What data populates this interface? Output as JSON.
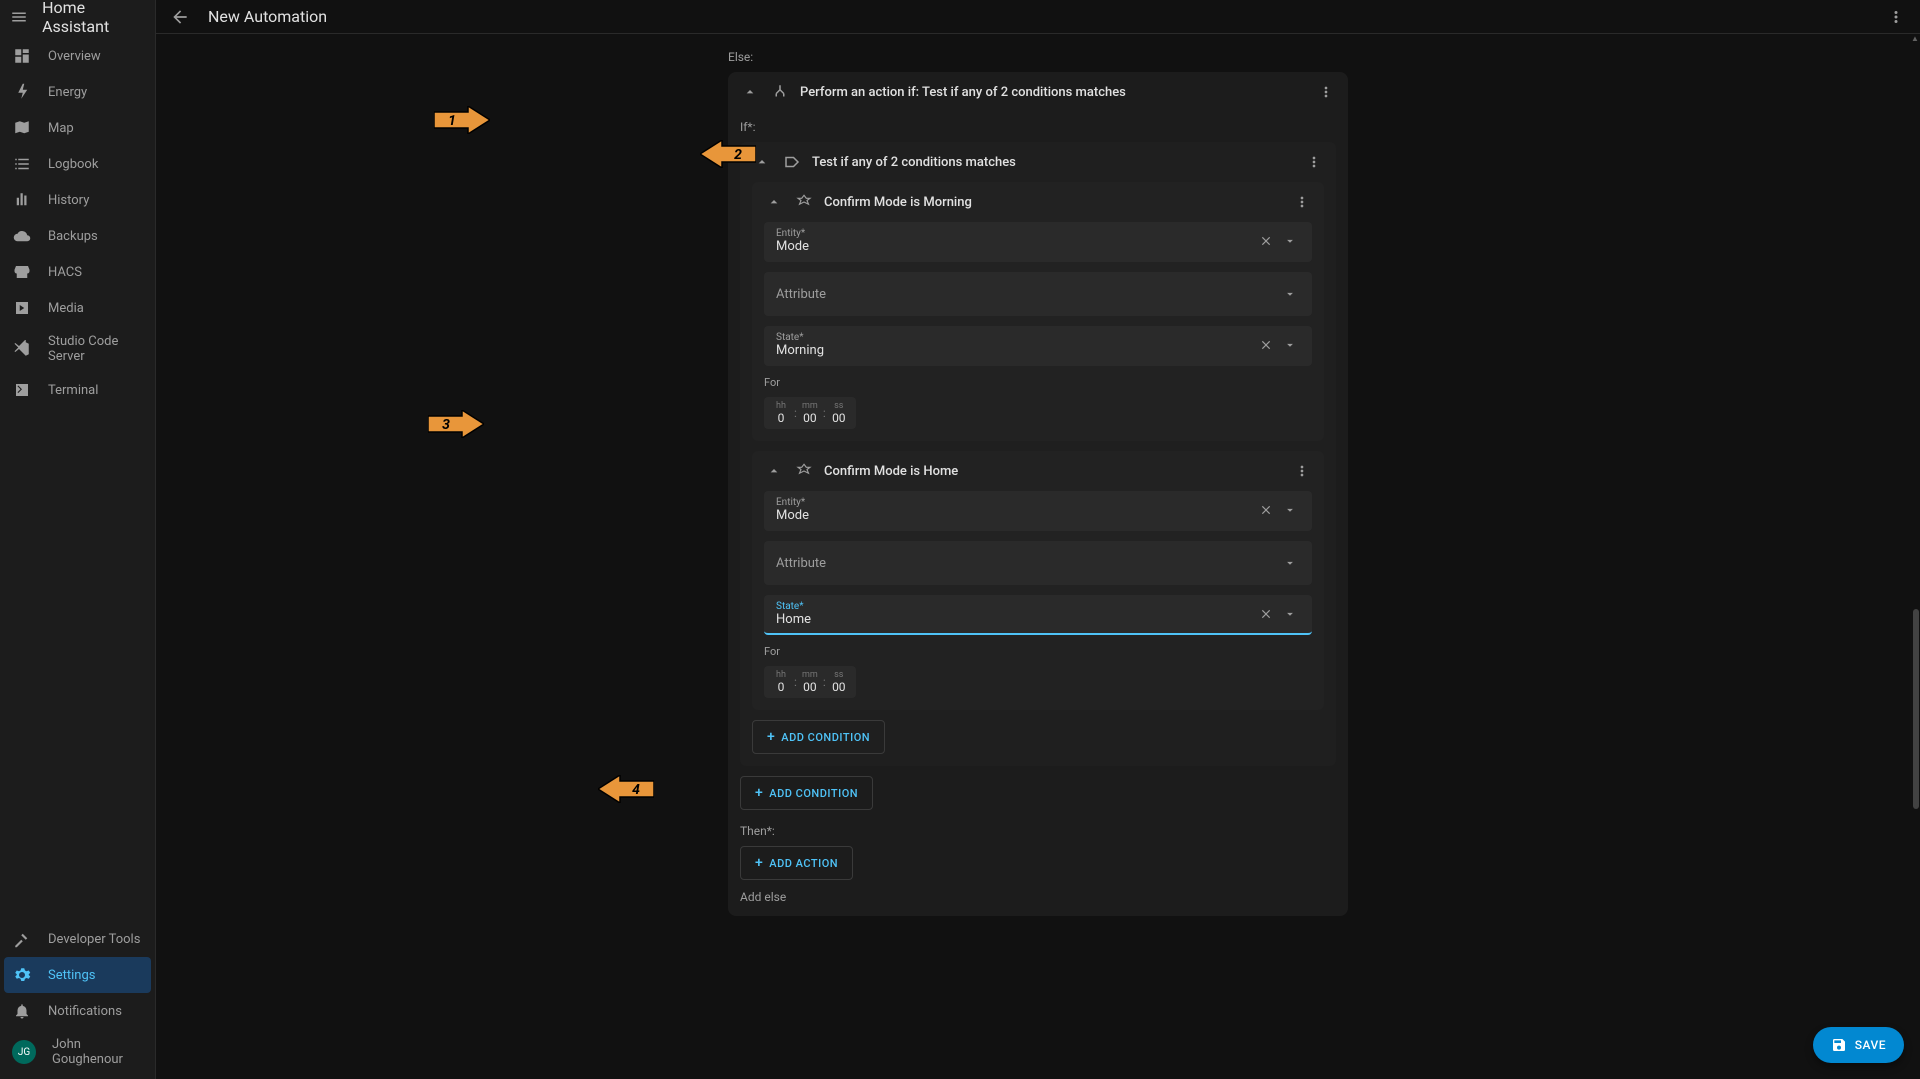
{
  "app": {
    "title": "Home Assistant",
    "page_title": "New Automation"
  },
  "sidebar": {
    "items": [
      {
        "label": "Overview"
      },
      {
        "label": "Energy"
      },
      {
        "label": "Map"
      },
      {
        "label": "Logbook"
      },
      {
        "label": "History"
      },
      {
        "label": "Backups"
      },
      {
        "label": "HACS"
      },
      {
        "label": "Media"
      },
      {
        "label": "Studio Code Server"
      },
      {
        "label": "Terminal"
      }
    ],
    "bottom": [
      {
        "label": "Developer Tools"
      },
      {
        "label": "Settings"
      },
      {
        "label": "Notifications"
      }
    ],
    "user": {
      "initials": "JG",
      "name": "John Goughenour"
    }
  },
  "editor": {
    "else_label": "Else:",
    "action_title": "Perform an action if: Test if any of 2 conditions matches",
    "if_label": "If*:",
    "test_title": "Test if any of 2 conditions matches",
    "cond1": {
      "title": "Confirm Mode is Morning",
      "entity_label": "Entity*",
      "entity_value": "Mode",
      "attribute_placeholder": "Attribute",
      "state_label": "State*",
      "state_value": "Morning",
      "for_label": "For",
      "hh_label": "hh",
      "mm_label": "mm",
      "ss_label": "ss",
      "hh": "0",
      "mm": "00",
      "ss": "00"
    },
    "cond2": {
      "title": "Confirm Mode is Home",
      "entity_label": "Entity*",
      "entity_value": "Mode",
      "attribute_placeholder": "Attribute",
      "state_label": "State*",
      "state_value": "Home",
      "for_label": "For",
      "hh_label": "hh",
      "mm_label": "mm",
      "ss_label": "ss",
      "hh": "0",
      "mm": "00",
      "ss": "00"
    },
    "add_condition_inner": "ADD CONDITION",
    "add_condition_outer": "ADD CONDITION",
    "then_label": "Then*:",
    "add_action": "ADD ACTION",
    "add_else": "Add else"
  },
  "save_label": "SAVE",
  "annotations": {
    "a1": "1",
    "a2": "2",
    "a3": "3",
    "a4": "4"
  }
}
